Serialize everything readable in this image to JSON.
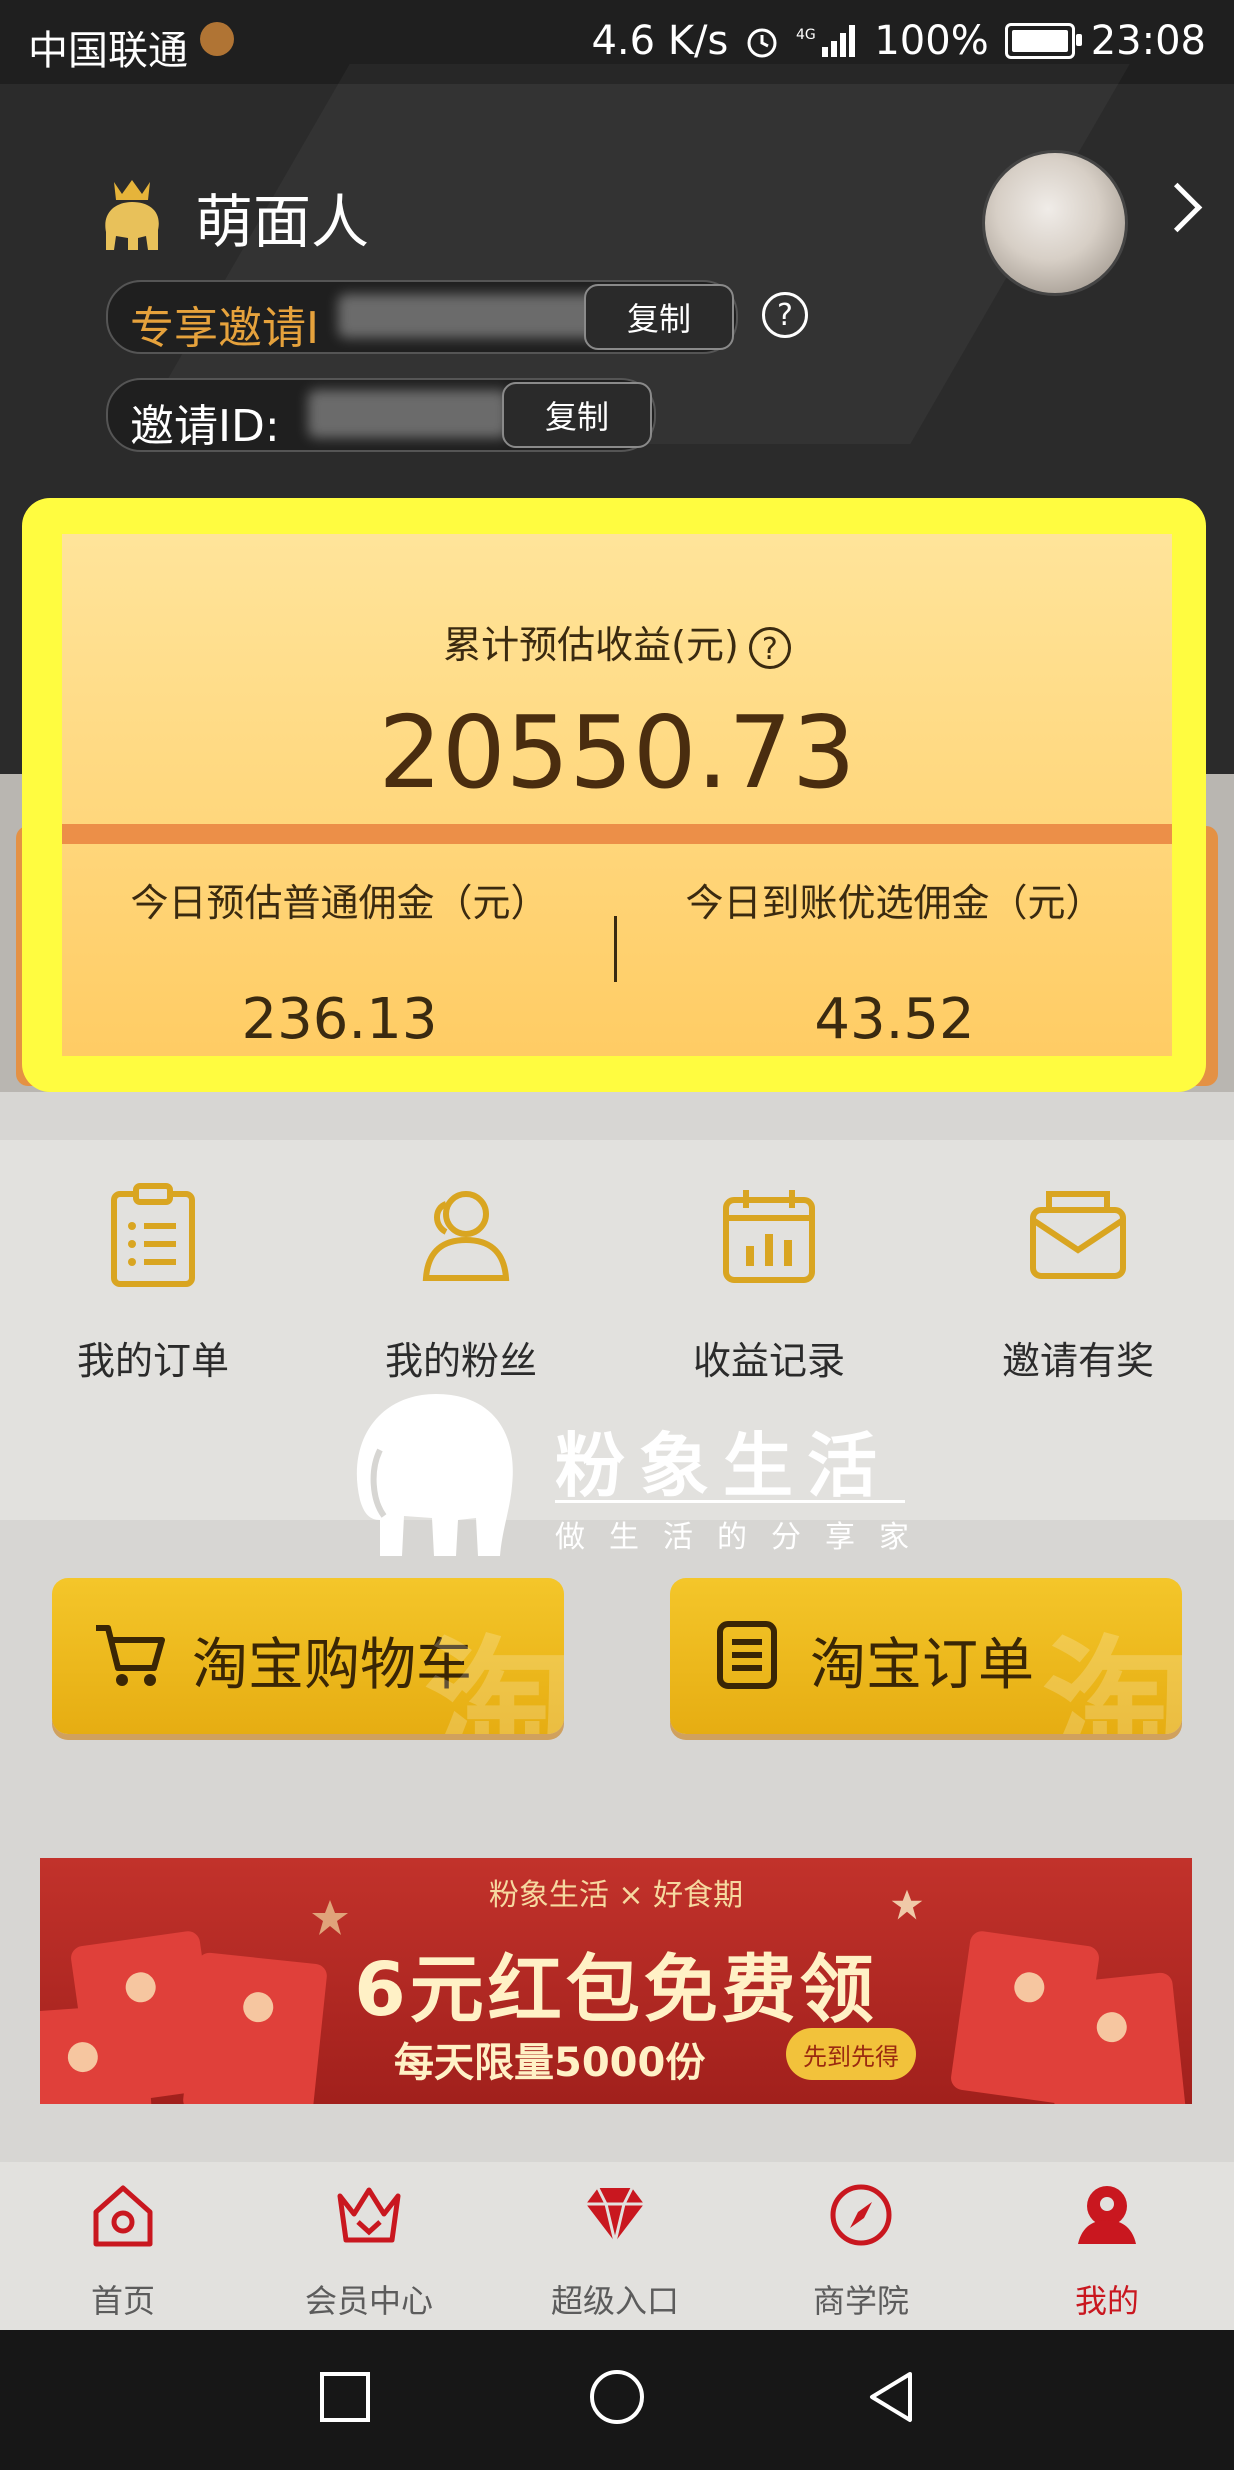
{
  "status_bar": {
    "carrier": "中国联通",
    "speed": "4.6 K/s",
    "battery": "100%",
    "time": "23:08"
  },
  "profile": {
    "username": "萌面人",
    "exclusive_invite_label": "专享邀请I",
    "invite_id_label": "邀请ID:",
    "copy_label": "复制",
    "help": "?"
  },
  "earnings": {
    "title": "累计预估收益(元)",
    "total": "20550.73",
    "left_label": "今日预估普通佣金（元）",
    "left_value": "236.13",
    "right_label": "今日到账优选佣金（元）",
    "right_value": "43.52"
  },
  "grid": [
    {
      "label": "我的订单",
      "icon": "clipboard-icon"
    },
    {
      "label": "我的粉丝",
      "icon": "fans-icon"
    },
    {
      "label": "收益记录",
      "icon": "calendar-chart-icon"
    },
    {
      "label": "邀请有奖",
      "icon": "envelope-icon"
    }
  ],
  "watermark": {
    "title": "粉象生活",
    "subtitle": "做生活的分享家"
  },
  "buttons": {
    "cart": "淘宝购物车",
    "orders": "淘宝订单",
    "bg_char": "淘"
  },
  "banner": {
    "brands": "粉象生活 × 好食期",
    "main": "6元红包免费领",
    "sub": "每天限量5000份",
    "badge": "先到先得"
  },
  "tabs": [
    {
      "label": "首页",
      "icon": "home-icon"
    },
    {
      "label": "会员中心",
      "icon": "crown-icon"
    },
    {
      "label": "超级入口",
      "icon": "diamond-icon"
    },
    {
      "label": "商学院",
      "icon": "compass-icon"
    },
    {
      "label": "我的",
      "icon": "profile-icon",
      "active": true
    }
  ],
  "colors": {
    "accent_red": "#c9171f",
    "gold": "#f4c62a",
    "highlight": "#fffc40"
  }
}
